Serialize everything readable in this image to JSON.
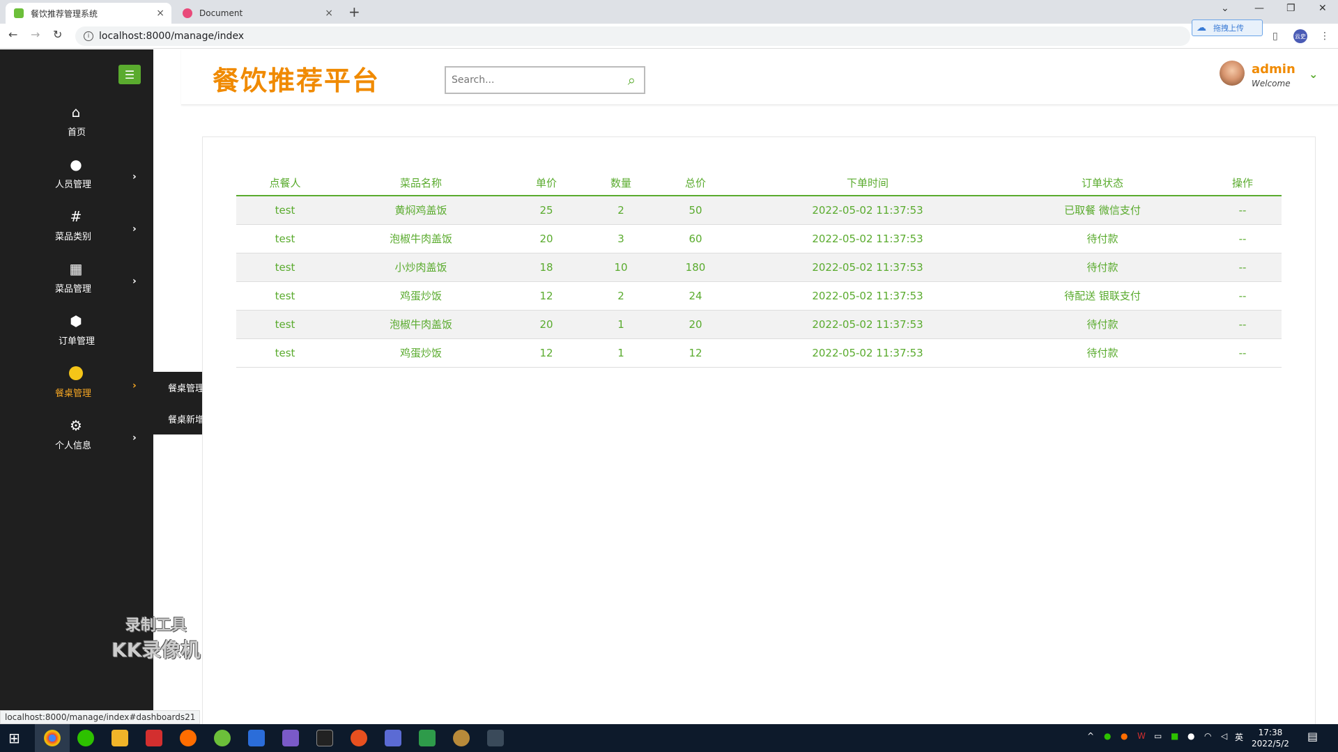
{
  "browser": {
    "tabs": [
      {
        "title": "餐饮推荐管理系统",
        "close": "×"
      },
      {
        "title": "Document",
        "close": "×"
      }
    ],
    "new_tab": "+",
    "url": "localhost:8000/manage/index",
    "upload_label": "拖拽上传",
    "profile_label": "云史",
    "status_url": "localhost:8000/manage/index#dashboards21"
  },
  "sidebar": {
    "items": [
      {
        "label": "首页",
        "icon": "home-icon",
        "has_arrow": false
      },
      {
        "label": "人员管理",
        "icon": "user-icon",
        "has_arrow": true
      },
      {
        "label": "菜品类别",
        "icon": "hash-icon",
        "has_arrow": true
      },
      {
        "label": "菜品管理",
        "icon": "grid-icon",
        "has_arrow": true
      },
      {
        "label": "订单管理",
        "icon": "box-icon",
        "has_arrow": false
      },
      {
        "label": "餐桌管理",
        "icon": "circle-icon",
        "has_arrow": true,
        "active": true
      },
      {
        "label": "个人信息",
        "icon": "gear-icon",
        "has_arrow": true
      }
    ],
    "submenu": [
      "餐桌管理",
      "餐桌新增"
    ],
    "watermark": {
      "line1": "录制工具",
      "line2": "KK录像机"
    }
  },
  "header": {
    "brand": "餐饮推荐平台",
    "search_placeholder": "Search...",
    "user_name": "admin",
    "user_welcome": "Welcome"
  },
  "table": {
    "columns": [
      "点餐人",
      "菜品名称",
      "单价",
      "数量",
      "总价",
      "下单时间",
      "订单状态",
      "操作"
    ],
    "rows": [
      [
        "test",
        "黄焖鸡盖饭",
        "25",
        "2",
        "50",
        "2022-05-02 11:37:53",
        "已取餐 微信支付",
        "--"
      ],
      [
        "test",
        "泡椒牛肉盖饭",
        "20",
        "3",
        "60",
        "2022-05-02 11:37:53",
        "待付款",
        "--"
      ],
      [
        "test",
        "小炒肉盖饭",
        "18",
        "10",
        "180",
        "2022-05-02 11:37:53",
        "待付款",
        "--"
      ],
      [
        "test",
        "鸡蛋炒饭",
        "12",
        "2",
        "24",
        "2022-05-02 11:37:53",
        "待配送 银联支付",
        "--"
      ],
      [
        "test",
        "泡椒牛肉盖饭",
        "20",
        "1",
        "20",
        "2022-05-02 11:37:53",
        "待付款",
        "--"
      ],
      [
        "test",
        "鸡蛋炒饭",
        "12",
        "1",
        "12",
        "2022-05-02 11:37:53",
        "待付款",
        "--"
      ]
    ]
  },
  "taskbar": {
    "time": "17:38",
    "date": "2022/5/2",
    "ime": "英"
  },
  "colors": {
    "accent_green": "#5aab2e",
    "brand_orange": "#f08a00",
    "sidebar_bg": "#1f1f1f"
  }
}
